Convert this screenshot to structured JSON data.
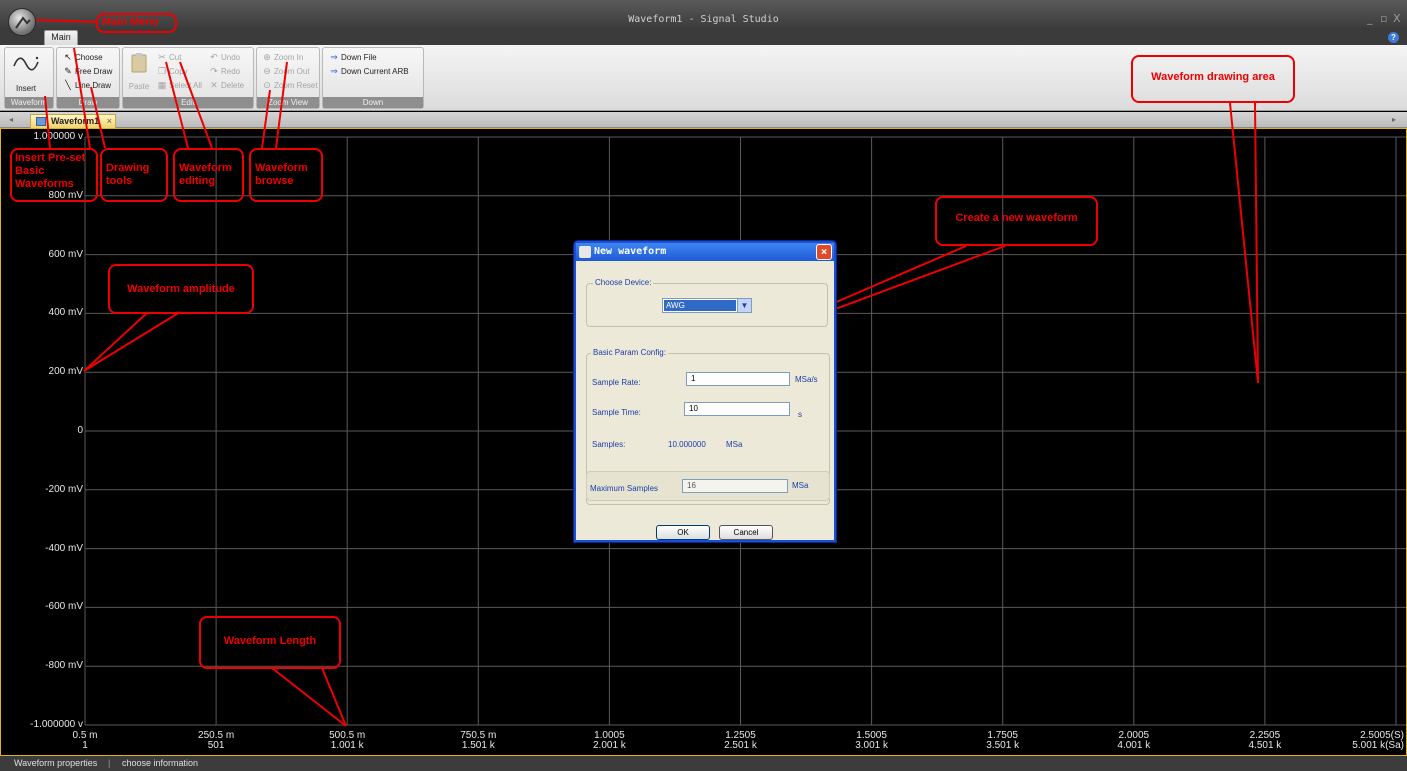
{
  "window": {
    "title": "Waveform1 - Signal Studio",
    "minimize": "_",
    "restore": "▫",
    "close": "X"
  },
  "tabs": {
    "main": "Main"
  },
  "ribbon": {
    "waveform_group": {
      "label": "Waveform",
      "insert": "Insert"
    },
    "draw_group": {
      "label": "Draw",
      "choose": "Choose",
      "free_draw": "Free Draw",
      "line_draw": "Line Draw"
    },
    "edit_group": {
      "label": "Edit",
      "paste": "Paste",
      "cut": "Cut",
      "copy": "Copy",
      "select_all": "Select All",
      "undo": "Undo",
      "redo": "Redo",
      "delete": "Delete"
    },
    "zoom_group": {
      "label": "Zoom View",
      "zoom_in": "Zoom In",
      "zoom_out": "Zoom Out",
      "zoom_reset": "Zoom Reset"
    },
    "down_group": {
      "label": "Down",
      "down_file": "Down File",
      "down_current_arb": "Down Current ARB"
    }
  },
  "doc_tab": {
    "label": "Waveform1",
    "close": "×"
  },
  "chart": {
    "y_labels": [
      "1.000000 v",
      "800   mV",
      "600   mV",
      "400   mV",
      "200   mV",
      "0",
      "-200   mV",
      "-400   mV",
      "-600   mV",
      "-800   mV",
      "-1.000000 v"
    ],
    "x_labels_top": [
      "0.5 m",
      "250.5 m",
      "500.5 m",
      "750.5 m",
      "1.0005",
      "1.2505",
      "1.5005",
      "1.7505",
      "2.0005",
      "2.2505",
      "2.5005(S)"
    ],
    "x_labels_bottom": [
      "1",
      "501",
      "1.001 k",
      "1.501 k",
      "2.001 k",
      "2.501 k",
      "3.001 k",
      "3.501 k",
      "4.001 k",
      "4.501 k",
      "5.001 k(Sa)"
    ]
  },
  "annotations": {
    "main_menu": "Main Menu",
    "drawing_area": "Waveform drawing area",
    "insert_preset": "Insert Pre-set Basic Waveforms",
    "drawing_tools": "Drawing tools",
    "waveform_editing": "Waveform editing",
    "waveform_browse": "Waveform browse",
    "create_new": "Create a new waveform",
    "amplitude": "Waveform amplitude",
    "length": "Waveform Length"
  },
  "dialog": {
    "title": "New waveform",
    "close": "×",
    "choose_device_legend": "Choose Device:",
    "device_value": "AWG",
    "basic_param_legend": "Basic Param Config:",
    "sample_rate_label": "Sample Rate:",
    "sample_rate_value": "1",
    "sample_rate_unit": "MSa/s",
    "sample_time_label": "Sample Time:",
    "sample_time_value": "10",
    "sample_time_unit": "s",
    "samples_label": "Samples:",
    "samples_value": "10.000000",
    "samples_unit": "MSa",
    "max_samples_label": "Maximum Samples",
    "max_samples_value": "16",
    "max_samples_unit": "MSa",
    "ok": "OK",
    "cancel": "Cancel"
  },
  "status": {
    "left": "Waveform properties",
    "right": "choose information"
  },
  "colors": {
    "annotation": "#e00000",
    "plot_bg": "#000000",
    "grid": "#5a5a5a",
    "dialog_title": "#1e5ad8"
  }
}
